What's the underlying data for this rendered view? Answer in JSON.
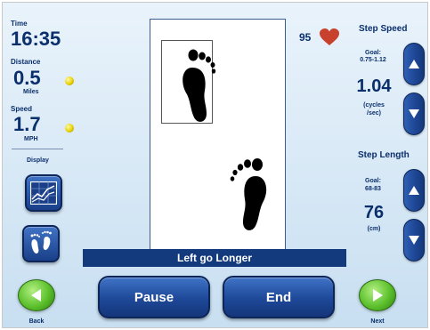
{
  "stats": {
    "time_label": "Time",
    "time_value": "16:35",
    "distance_label": "Distance",
    "distance_value": "0.5",
    "distance_unit": "Miles",
    "speed_label": "Speed",
    "speed_value": "1.7",
    "speed_unit": "MPH",
    "display_label": "Display",
    "indicator_color": "#e8d100"
  },
  "heart_rate": {
    "value": "95",
    "icon": "heart-icon",
    "color": "#c8412c"
  },
  "step_speed": {
    "title": "Step Speed",
    "goal_label": "Goal:",
    "goal_value": "0.75-1.12",
    "value": "1.04",
    "unit_line1": "(cycles",
    "unit_line2": "/sec)"
  },
  "step_length": {
    "title": "Step Length",
    "goal_label": "Goal:",
    "goal_value": "68-83",
    "value": "76",
    "unit": "(cm)"
  },
  "left_buttons": {
    "chart_icon": "line-chart-icon",
    "feet_icon": "footprints-icon"
  },
  "message": "Left go Longer",
  "controls": {
    "pause_label": "Pause",
    "end_label": "End",
    "back_label": "Back",
    "next_label": "Next"
  },
  "colors": {
    "primary_blue": "#1e4898",
    "banner_blue": "#133a7c",
    "nav_green": "#5cc02c",
    "text_dark": "#0b2f6c"
  }
}
